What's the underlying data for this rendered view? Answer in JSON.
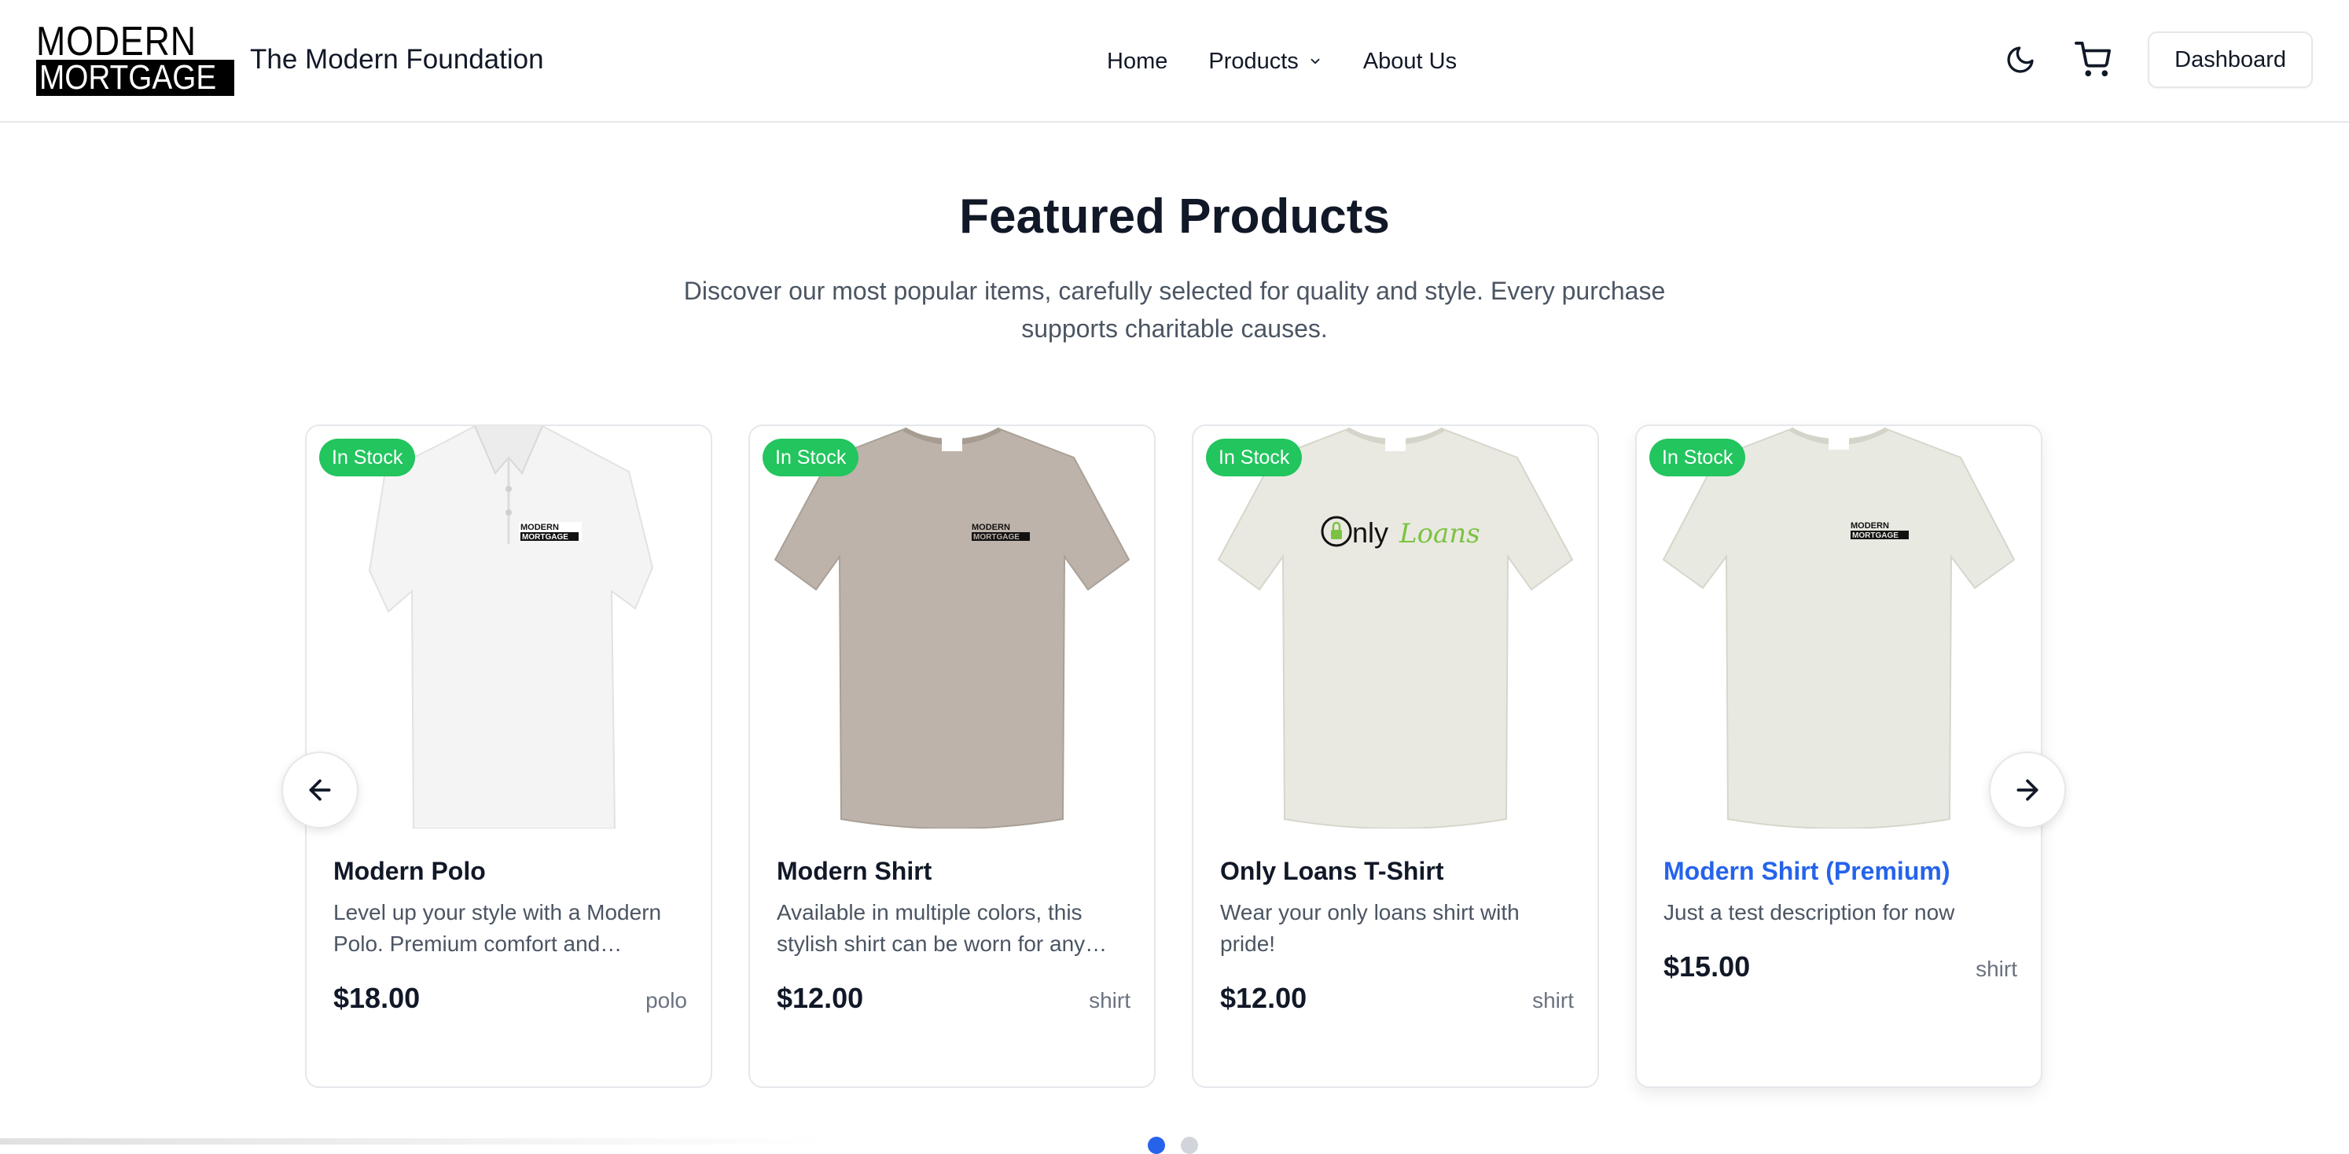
{
  "header": {
    "logo_top": "MODERN",
    "logo_bottom": "MORTGAGE",
    "site_name": "The Modern Foundation",
    "nav": [
      {
        "label": "Home"
      },
      {
        "label": "Products"
      },
      {
        "label": "About Us"
      }
    ],
    "dashboard_label": "Dashboard",
    "icons": [
      "moon-icon",
      "cart-icon"
    ]
  },
  "featured": {
    "title": "Featured Products",
    "subtitle": "Discover our most popular items, carefully selected for quality and style. Every purchase supports charitable causes."
  },
  "products": [
    {
      "badge": "In Stock",
      "name": "Modern Polo",
      "description": "Level up your style with a Modern Polo. Premium comfort and…",
      "price": "$18.00",
      "category": "polo",
      "shirt_color": "#f4f4f4",
      "logo_text": "MODERN MORTGAGE"
    },
    {
      "badge": "In Stock",
      "name": "Modern Shirt",
      "description": "Available in multiple colors, this stylish shirt can be worn for any…",
      "price": "$12.00",
      "category": "shirt",
      "shirt_color": "#bdb3aa",
      "logo_text": "MODERN MORTGAGE"
    },
    {
      "badge": "In Stock",
      "name": "Only Loans T-Shirt",
      "description": "Wear your only loans shirt with pride!",
      "price": "$12.00",
      "category": "shirt",
      "shirt_color": "#e9e9e1",
      "logo_text": "OnlyLoans"
    },
    {
      "badge": "In Stock",
      "name": "Modern Shirt (Premium)",
      "description": "Just a test description for now",
      "price": "$15.00",
      "category": "shirt",
      "shirt_color": "#e8e9e1",
      "logo_text": "MODERN MORTGAGE"
    }
  ],
  "carousel": {
    "active_page": 1,
    "page_count": 2
  },
  "colors": {
    "accent": "#2563eb",
    "badge": "#22c55e",
    "dot_inactive": "#d1d5db"
  }
}
